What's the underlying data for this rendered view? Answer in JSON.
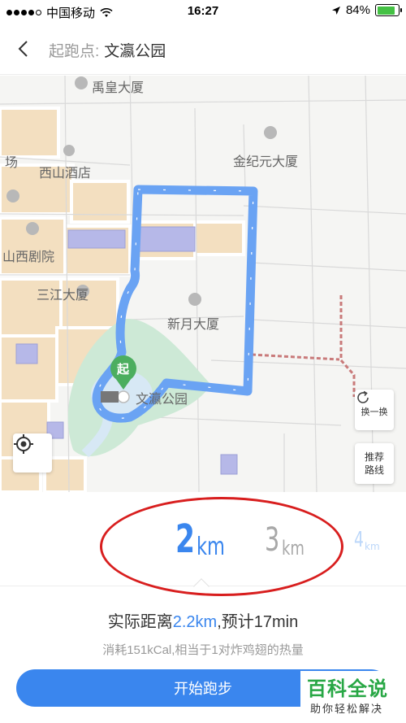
{
  "status_bar": {
    "carrier": "中国移动",
    "time": "16:27",
    "battery": "84%",
    "battery_level": 0.84
  },
  "header": {
    "label": "起跑点:",
    "value": "文瀛公园"
  },
  "map": {
    "places": {
      "yuhuang": "禹皇大厦",
      "chang": "场",
      "xishan": "西山酒店",
      "jinji": "金纪元大厦",
      "shanxi": "山西剧院",
      "sanjiang": "三江大厦",
      "xinyue": "新月大厦",
      "wenying": "文瀛公园"
    },
    "start_marker": "起",
    "swap_label": "换一换",
    "route_label_1": "推荐",
    "route_label_2": "路线",
    "route_color": "#6aa3f3"
  },
  "distances": {
    "d1_num": "2",
    "d1_unit": "km",
    "d2_num": "3",
    "d2_unit": "km",
    "d3_num": "4",
    "d3_unit": "km"
  },
  "info": {
    "line1_a": "实际距离",
    "line1_dist": "2.2km",
    "line1_b": ",预计17min",
    "line2": "消耗151kCal,相当于1对炸鸡翅的热量"
  },
  "start_button": "开始跑步",
  "watermark": {
    "title": "百科全说",
    "subtitle": "助你轻松解决"
  },
  "colors": {
    "accent": "#3a86ee",
    "annotation": "#d81e1e",
    "watermark": "#28a745"
  }
}
